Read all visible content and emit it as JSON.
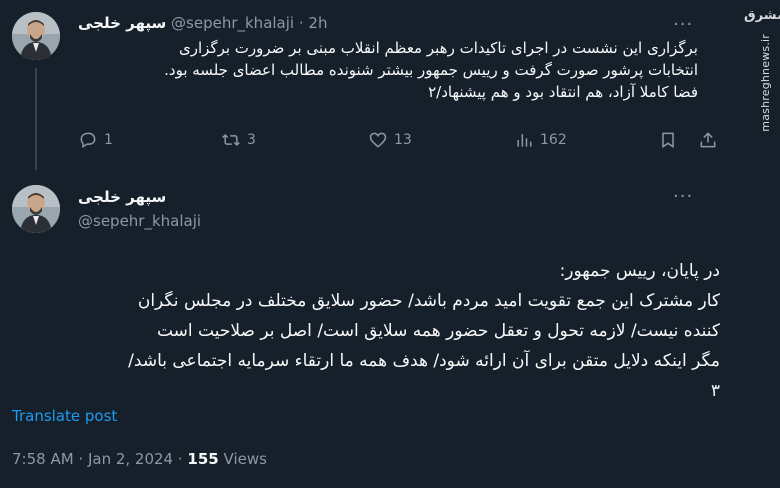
{
  "watermark": {
    "logo": "مشرق",
    "site": "mashreghnews.ir"
  },
  "tweet1": {
    "author_name": "سپهر خلجی",
    "handle": "@sepehr_khalaji",
    "separator": "·",
    "time": "2h",
    "more": "···",
    "lines": [
      "برگزاری این نشست در اجرای تاکیدات رهبر معظم انقلاب مبنی بر ضرورت برگزاری",
      "انتخابات پرشور صورت گرفت و رییس جمهور بیشتر شنونده مطالب اعضای جلسه بود.",
      "فضا کاملا آزاد، هم انتقاد بود و هم پیشنهاد/۲"
    ],
    "actions": {
      "replies": "1",
      "reposts": "3",
      "likes": "13",
      "views": "162"
    }
  },
  "tweet2": {
    "author_name": "سپهر خلجی",
    "handle": "@sepehr_khalaji",
    "more": "···",
    "lines": [
      "در پایان، رییس جمهور:",
      "کار مشترک این جمع تقویت امید مردم باشد/ حضور سلایق مختلف در مجلس نگران",
      "کننده نیست/ لازمه تحول و تعقل حضور همه سلایق است/ اصل بر صلاحیت است",
      "مگر اینکه دلایل متقن برای آن ارائه شود/ هدف همه ما ارتقاء سرمایه اجتماعی باشد/",
      "۳"
    ],
    "translate_label": "Translate post",
    "timestamp": "7:58 AM · Jan 2, 2024 ·",
    "views_count": "155",
    "views_label": "Views"
  },
  "colors": {
    "background": "#15202b",
    "text_primary": "#f7f9f9",
    "text_secondary": "#8b98a5",
    "link": "#1d9bf0",
    "divider": "#38444d"
  },
  "icons": {
    "reply": "reply-icon",
    "repost": "repost-icon",
    "like": "heart-icon",
    "views": "views-chart-icon",
    "bookmark": "bookmark-icon",
    "share": "share-icon"
  }
}
